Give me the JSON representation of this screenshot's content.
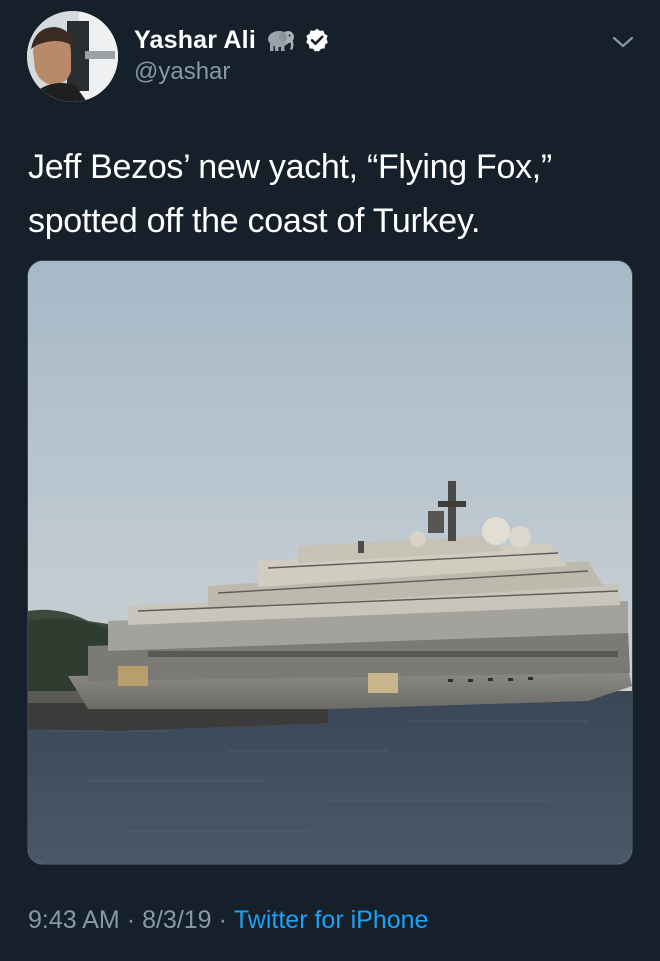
{
  "author": {
    "display_name": "Yashar Ali",
    "handle": "@yashar",
    "name_emoji_icon": "elephant-icon",
    "verified_icon": "verified-badge-icon",
    "avatar": "avatar"
  },
  "tweet": {
    "text": "Jeff Bezos’ new yacht, “Flying Fox,” spotted off the coast of Turkey.",
    "media_icon": "yacht-photo"
  },
  "meta": {
    "time": "9:43 AM",
    "separator": "·",
    "date": "8/3/19",
    "source": "Twitter for iPhone"
  },
  "menu": {
    "icon": "chevron-down-icon"
  },
  "colors": {
    "background": "#15202b",
    "text": "#ffffff",
    "secondary": "#8899a6",
    "link": "#1da1f2"
  }
}
